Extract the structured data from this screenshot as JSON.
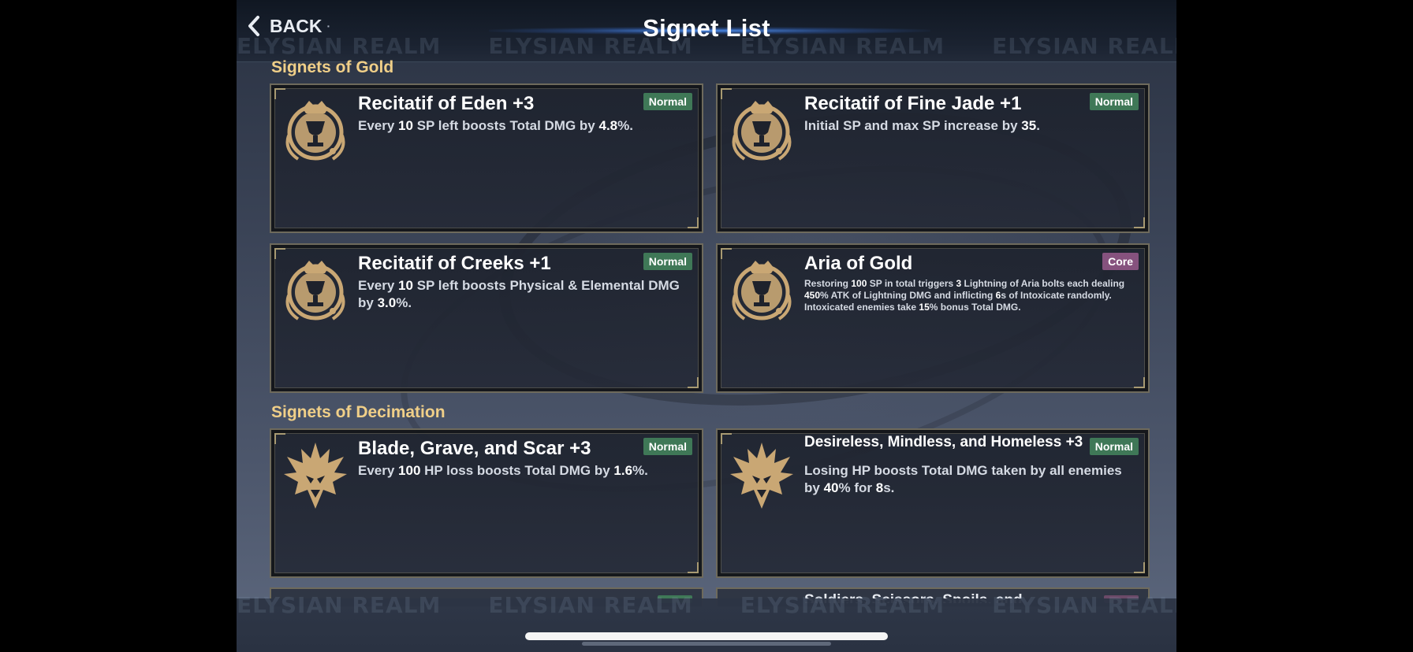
{
  "header": {
    "back_label": "BACK",
    "title": "Signet List",
    "watermark": "ELYSIAN REALM"
  },
  "sections": [
    {
      "title": "Signets of Gold",
      "cards": [
        {
          "name": "Recitatif of Eden +3",
          "tag": "Normal",
          "icon": "gold-chalice-icon",
          "desc": [
            "Every ",
            {
              "n": "10"
            },
            " SP left boosts Total DMG by ",
            {
              "n": "4.8"
            },
            "%."
          ]
        },
        {
          "name": "Recitatif of Fine Jade +1",
          "tag": "Normal",
          "icon": "gold-chalice-icon",
          "desc": [
            "Initial SP and max SP increase by ",
            {
              "n": "35"
            },
            "."
          ]
        },
        {
          "name": "Recitatif of Creeks +1",
          "tag": "Normal",
          "icon": "gold-chalice-icon",
          "desc": [
            "Every ",
            {
              "n": "10"
            },
            " SP left boosts Physical & Elemental DMG by ",
            {
              "n": "3.0"
            },
            "%."
          ]
        },
        {
          "name": "Aria of Gold",
          "tag": "Core",
          "icon": "gold-chalice-icon",
          "desc_lines": [
            [
              "Restoring ",
              {
                "n": "100"
              },
              " SP in total triggers ",
              {
                "n": "3"
              },
              " Lightning of Aria bolts each dealing"
            ],
            [
              {
                "n": "450"
              },
              "% ATK of Lightning DMG and inflicting ",
              {
                "n": "6"
              },
              "s of Intoxicate randomly."
            ],
            [
              "Intoxicated enemies take ",
              {
                "n": "15"
              },
              "% bonus Total DMG."
            ]
          ]
        }
      ]
    },
    {
      "title": "Signets of Decimation",
      "cards": [
        {
          "name": "Blade, Grave, and Scar +3",
          "tag": "Normal",
          "icon": "decimation-crest-icon",
          "desc": [
            "Every ",
            {
              "n": "100"
            },
            " HP loss boosts Total DMG by ",
            {
              "n": "1.6"
            },
            "%."
          ]
        },
        {
          "name": "Desireless, Mindless, and Homeless +3",
          "tag": "Normal",
          "icon": "decimation-crest-icon",
          "desc": [
            "Losing HP boosts Total DMG taken by all enemies by ",
            {
              "n": "40"
            },
            "% for ",
            {
              "n": "8"
            },
            "s."
          ]
        }
      ],
      "partial_cards": [
        {
          "name": "",
          "tag_color": "#3f7857"
        },
        {
          "name": "Soldiers, Scissors, Spoils, and",
          "tag_color": "#6b4a68"
        }
      ]
    }
  ],
  "colors": {
    "section_title": "#f0cf88",
    "tag_normal": "#3f7857",
    "tag_core": "#86527e",
    "icon_gold": "#c9a774"
  }
}
